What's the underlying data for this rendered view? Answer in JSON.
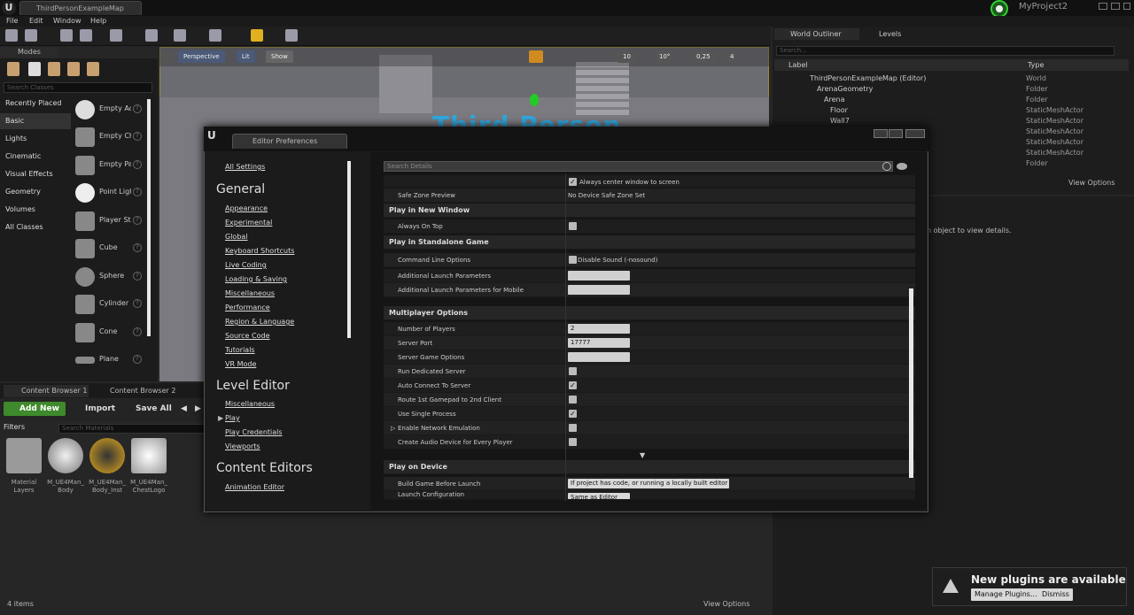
{
  "window": {
    "tab_title": "ThirdPersonExampleMap",
    "project_name": "MyProject2"
  },
  "menu": [
    "File",
    "Edit",
    "Window",
    "Help"
  ],
  "modes": {
    "tab_label": "Modes",
    "search_placeholder": "Search Classes",
    "categories": [
      "Recently Placed",
      "Basic",
      "Lights",
      "Cinematic",
      "Visual Effects",
      "Geometry",
      "Volumes",
      "All Classes"
    ],
    "classes": [
      "Empty Actor",
      "Empty Character",
      "Empty Pawn",
      "Point Light",
      "Player Start",
      "Cube",
      "Sphere",
      "Cylinder",
      "Cone",
      "Plane"
    ]
  },
  "viewport": {
    "perspective_label": "Perspective",
    "lit_label": "Lit",
    "show_label": "Show",
    "grid_value": "10",
    "rotation_value": "10°",
    "scale_value": "0,25",
    "camera_speed": "4",
    "overlay_text": "Third Person"
  },
  "content_browser": {
    "tabs": [
      "Content Browser 1",
      "Content Browser 2"
    ],
    "add_new_label": "Add New",
    "import_label": "Import",
    "save_all_label": "Save All",
    "filters_label": "Filters",
    "search_placeholder": "Search Materials",
    "assets": [
      {
        "name": "Material Layers",
        "color": "#9a9a9a"
      },
      {
        "name": "M_UE4Man_ Body",
        "color": "#c8c8c8"
      },
      {
        "name": "M_UE4Man_ Body_Inst",
        "color": "#e0a81e"
      },
      {
        "name": "M_UE4Man_ ChestLogo",
        "color": "#eeeeee"
      }
    ],
    "items_count": "4 items",
    "view_options": "View Options"
  },
  "outliner": {
    "tabs": [
      "World Outliner",
      "Levels"
    ],
    "search_placeholder": "Search...",
    "col_label": "Label",
    "col_type": "Type",
    "rows": [
      {
        "label": "ThirdPersonExampleMap (Editor)",
        "type": "World"
      },
      {
        "label": "ArenaGeometry",
        "type": "Folder"
      },
      {
        "label": "Arena",
        "type": "Folder"
      },
      {
        "label": "Floor",
        "type": "StaticMeshActor"
      },
      {
        "label": "Wall7",
        "type": "StaticMeshActor"
      },
      {
        "label": "",
        "type": "StaticMeshActor"
      },
      {
        "label": "",
        "type": "StaticMeshActor"
      },
      {
        "label": "",
        "type": "StaticMeshActor"
      },
      {
        "label": "",
        "type": "Folder"
      }
    ],
    "view_options": "View Options"
  },
  "details": {
    "message": "n object to view details."
  },
  "toast": {
    "title": "New plugins are available",
    "manage_label": "Manage Plugins...",
    "dismiss_label": "Dismiss"
  },
  "prefs": {
    "tab_title": "Editor Preferences",
    "search_placeholder": "Search Details",
    "all_settings": "All Settings",
    "general_heading": "General",
    "general_links": [
      "Appearance",
      "Experimental",
      "Global",
      "Keyboard Shortcuts",
      "Live Coding",
      "Loading & Saving",
      "Miscellaneous",
      "Performance",
      "Region & Language",
      "Source Code",
      "Tutorials",
      "VR Mode"
    ],
    "level_heading": "Level Editor",
    "level_links": [
      "Miscellaneous",
      "Play",
      "Play Credentials",
      "Viewports"
    ],
    "content_heading": "Content Editors",
    "content_links": [
      "Animation Editor"
    ],
    "always_center": "Always center window to screen",
    "safe_zone_label": "Safe Zone Preview",
    "safe_zone_value": "No Device Safe Zone Set",
    "sec_new_window": "Play in New Window",
    "always_on_top": "Always On Top",
    "sec_standalone": "Play in Standalone Game",
    "cmd_line": "Command Line Options",
    "disable_sound": "Disable Sound (-nosound)",
    "add_launch": "Additional Launch Parameters",
    "add_launch_mobile": "Additional Launch Parameters for Mobile",
    "sec_multiplayer": "Multiplayer Options",
    "num_players_label": "Number of Players",
    "num_players_value": "2",
    "server_port_label": "Server Port",
    "server_port_value": "17777",
    "server_game_options": "Server Game Options",
    "run_dedicated": "Run Dedicated Server",
    "auto_connect": "Auto Connect To Server",
    "route_gamepad": "Route 1st Gamepad to 2nd Client",
    "single_process": "Use Single Process",
    "network_emulation": "Enable Network Emulation",
    "create_audio": "Create Audio Device for Every Player",
    "sec_device": "Play on Device",
    "build_game_label": "Build Game Before Launch",
    "build_game_value": "If project has code, or running a locally built editor",
    "launch_config_label": "Launch Configuration",
    "launch_config_value": "Same as Editor"
  }
}
